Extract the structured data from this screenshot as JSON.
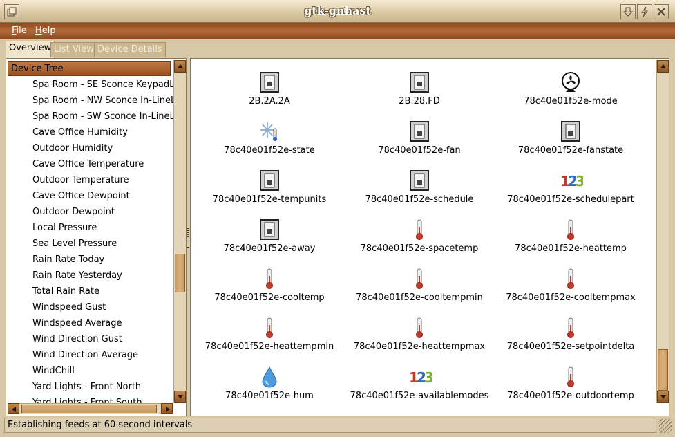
{
  "window": {
    "title": "gtk-gnhast"
  },
  "menu": [
    {
      "label": "File",
      "accel": "F",
      "rest": "ile"
    },
    {
      "label": "Help",
      "accel": "H",
      "rest": "elp"
    }
  ],
  "tabs": [
    {
      "label": "Overview",
      "active": true
    },
    {
      "label": "List View",
      "active": false
    },
    {
      "label": "Device Details",
      "active": false
    }
  ],
  "tree": {
    "header": "Device Tree",
    "items": [
      "Spa Room - SE Sconce KeypadL",
      "Spa Room - NW Sconce In-LineL",
      "Spa Room - SW Sconce In-LineL",
      "Cave Office Humidity",
      "Outdoor Humidity",
      "Cave Office Temperature",
      "Outdoor Temperature",
      "Cave Office Dewpoint",
      "Outdoor Dewpoint",
      "Local Pressure",
      "Sea Level Pressure",
      "Rain Rate Today",
      "Rain Rate Yesterday",
      "Total Rain Rate",
      "Windspeed Gust",
      "Windspeed Average",
      "Wind Direction Gust",
      "Wind Direction Average",
      "WindChill",
      "Yard Lights - Front North",
      "Yard Lights - Front South"
    ]
  },
  "devices": [
    {
      "label": "2B.2A.2A",
      "icon": "switch-icon"
    },
    {
      "label": "2B.28.FD",
      "icon": "switch-icon"
    },
    {
      "label": "78c40e01f52e-mode",
      "icon": "fan-icon"
    },
    {
      "label": "78c40e01f52e-state",
      "icon": "snowflake-thermometer-icon"
    },
    {
      "label": "78c40e01f52e-fan",
      "icon": "switch-icon"
    },
    {
      "label": "78c40e01f52e-fanstate",
      "icon": "switch-icon"
    },
    {
      "label": "78c40e01f52e-tempunits",
      "icon": "switch-icon"
    },
    {
      "label": "78c40e01f52e-schedule",
      "icon": "switch-icon"
    },
    {
      "label": "78c40e01f52e-schedulepart",
      "icon": "number-123-icon"
    },
    {
      "label": "78c40e01f52e-away",
      "icon": "switch-icon"
    },
    {
      "label": "78c40e01f52e-spacetemp",
      "icon": "thermometer-icon"
    },
    {
      "label": "78c40e01f52e-heattemp",
      "icon": "thermometer-icon"
    },
    {
      "label": "78c40e01f52e-cooltemp",
      "icon": "thermometer-icon"
    },
    {
      "label": "78c40e01f52e-cooltempmin",
      "icon": "thermometer-icon"
    },
    {
      "label": "78c40e01f52e-cooltempmax",
      "icon": "thermometer-icon"
    },
    {
      "label": "78c40e01f52e-heattempmin",
      "icon": "thermometer-icon"
    },
    {
      "label": "78c40e01f52e-heattempmax",
      "icon": "thermometer-icon"
    },
    {
      "label": "78c40e01f52e-setpointdelta",
      "icon": "thermometer-icon"
    },
    {
      "label": "78c40e01f52e-hum",
      "icon": "water-drop-icon"
    },
    {
      "label": "78c40e01f52e-availablemodes",
      "icon": "number-123-icon"
    },
    {
      "label": "78c40e01f52e-outdoortemp",
      "icon": "thermometer-icon"
    }
  ],
  "status": {
    "text": "Establishing feeds at 60 second intervals"
  },
  "colors": {
    "menubar": "#a35f30",
    "tree_header": "#b06a36",
    "background": "#d6c7a6"
  }
}
